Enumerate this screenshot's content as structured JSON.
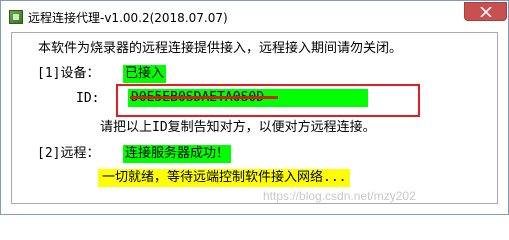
{
  "window": {
    "title": "远程连接代理-v1.00.2(2018.07.07)",
    "close_glyph": "✕"
  },
  "content": {
    "intro": "本软件为烧录器的远程连接提供接入，远程接入期间请勿关闭。",
    "device_label": "[1]设备：",
    "device_status": "已接入",
    "id_label": "ID:",
    "id_value": "D0E5EB0SDAETA0S0D",
    "id_hint": "请把以上ID复制告知对方，以便对方远程连接。",
    "remote_label": "[2]远程：",
    "remote_status": "连接服务器成功！",
    "remote_detail": "一切就绪，等待远端控制软件接入网络..."
  },
  "watermark": "https://blog.csdn.net/mzy202",
  "colors": {
    "highlight_green": "#00ff00",
    "highlight_yellow": "#ffff00",
    "annotation_red": "#e02020"
  }
}
